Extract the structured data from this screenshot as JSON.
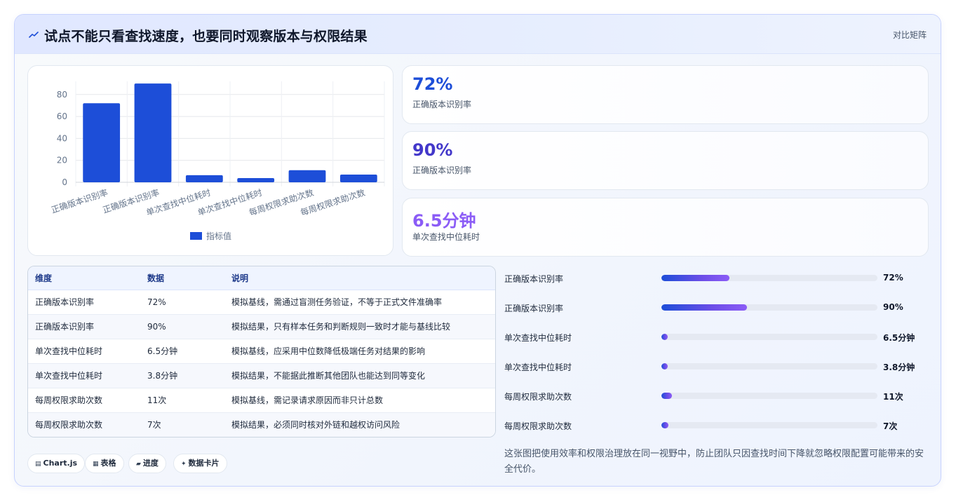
{
  "header": {
    "title": "试点不能只看查找速度，也要同时观察版本与权限结果",
    "right_label": "对比矩阵"
  },
  "chart_data": {
    "type": "bar",
    "categories": [
      "正确版本识别率",
      "正确版本识别率",
      "单次查找中位耗时",
      "单次查找中位耗时",
      "每周权限求助次数",
      "每周权限求助次数"
    ],
    "series": [
      {
        "name": "指标值",
        "values": [
          72,
          90,
          6.5,
          3.8,
          11,
          7
        ]
      }
    ],
    "yticks": [
      0,
      20,
      40,
      60,
      80
    ],
    "ylim": [
      0,
      92
    ],
    "grid": true,
    "legend": "bottom",
    "color": "#1d4ed8"
  },
  "kpis": [
    {
      "value": "72%",
      "label": "正确版本识别率",
      "color": "#1d4ed8"
    },
    {
      "value": "90%",
      "label": "正确版本识别率",
      "color": "#4338ca"
    },
    {
      "value": "6.5分钟",
      "label": "单次查找中位耗时",
      "color": "#8b5cf6"
    }
  ],
  "table": {
    "headers": [
      "维度",
      "数据",
      "说明"
    ],
    "rows": [
      [
        "正确版本识别率",
        "72%",
        "模拟基线，需通过盲测任务验证，不等于正式文件准确率"
      ],
      [
        "正确版本识别率",
        "90%",
        "模拟结果，只有样本任务和判断规则一致时才能与基线比较"
      ],
      [
        "单次查找中位耗时",
        "6.5分钟",
        "模拟基线，应采用中位数降低极端任务对结果的影响"
      ],
      [
        "单次查找中位耗时",
        "3.8分钟",
        "模拟结果，不能据此推断其他团队也能达到同等变化"
      ],
      [
        "每周权限求助次数",
        "11次",
        "模拟基线，需记录请求原因而非只计总数"
      ],
      [
        "每周权限求助次数",
        "7次",
        "模拟结果，必须同时核对外链和越权访问风险"
      ]
    ]
  },
  "progress": [
    {
      "label": "正确版本识别率",
      "value": "72%",
      "fraction": 0.316
    },
    {
      "label": "正确版本识别率",
      "value": "90%",
      "fraction": 0.395
    },
    {
      "label": "单次查找中位耗时",
      "value": "6.5分钟",
      "fraction": 0.029
    },
    {
      "label": "单次查找中位耗时",
      "value": "3.8分钟",
      "fraction": 0.029
    },
    {
      "label": "每周权限求助次数",
      "value": "11次",
      "fraction": 0.048
    },
    {
      "label": "每周权限求助次数",
      "value": "7次",
      "fraction": 0.031
    }
  ],
  "note": "这张图把使用效率和权限治理放在同一视野中，防止团队只因查找时间下降就忽略权限配置可能带来的安全代价。",
  "chips": [
    {
      "icon": "▤",
      "label": "Chart.js"
    },
    {
      "icon": "▦",
      "label": "表格"
    },
    {
      "icon": "▰",
      "label": "进度"
    },
    {
      "icon": "✦",
      "label": "数据卡片"
    }
  ],
  "colors": {
    "accent": "#1d4ed8",
    "violet": "#8b5cf6",
    "indigo": "#4338ca"
  }
}
